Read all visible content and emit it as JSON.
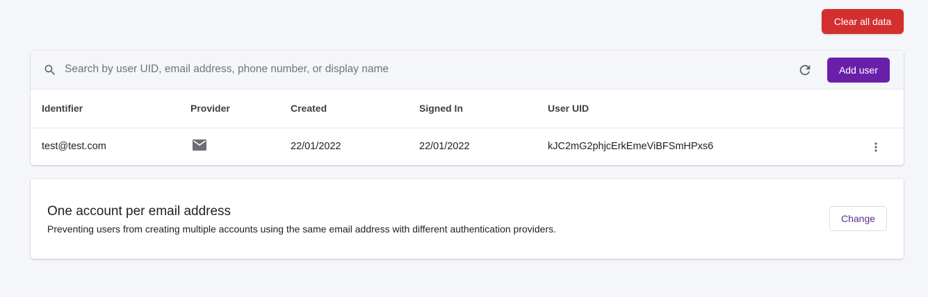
{
  "header": {
    "clear_label": "Clear all data"
  },
  "search": {
    "placeholder": "Search by user UID, email address, phone number, or display name",
    "value": ""
  },
  "toolbar": {
    "add_user_label": "Add user",
    "refresh_icon": "refresh-icon"
  },
  "table": {
    "columns": [
      "Identifier",
      "Provider",
      "Created",
      "Signed In",
      "User UID"
    ],
    "rows": [
      {
        "identifier": "test@test.com",
        "provider_icon": "email-icon",
        "created": "22/01/2022",
        "signed_in": "22/01/2022",
        "uid": "kJC2mG2phjcErkEmeViBFSmHPxs6",
        "menu_icon": "more-vert-icon"
      }
    ]
  },
  "policy": {
    "title": "One account per email address",
    "description": "Preventing users from creating multiple accounts using the same email address with different authentication providers.",
    "change_label": "Change"
  },
  "colors": {
    "danger": "#d32f2f",
    "primary": "#6a1fa9",
    "background": "#f5f6f9"
  }
}
